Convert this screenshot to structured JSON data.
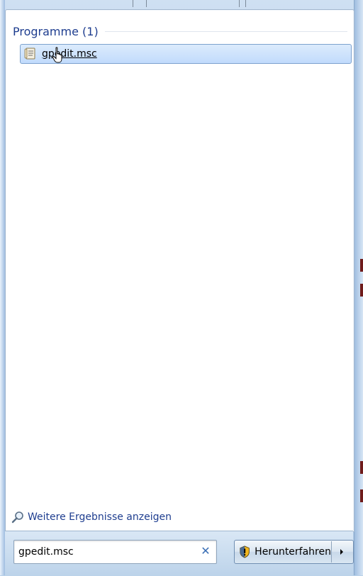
{
  "results": {
    "group_header": "Programme (1)",
    "items": [
      {
        "label": "gpedit.msc",
        "icon": "msc-document-icon"
      }
    ]
  },
  "more_results": {
    "label": "Weitere Ergebnisse anzeigen",
    "icon": "magnifier-icon"
  },
  "search": {
    "value": "gpedit.msc",
    "clear_icon": "clear-x-icon"
  },
  "shutdown": {
    "label": "Herunterfahren",
    "icon": "uac-shield-icon",
    "arrow_icon": "chevron-right-icon"
  },
  "colors": {
    "header_text": "#1e3d8f",
    "selection_fill": "#c1dbfc",
    "selection_border": "#7da2ce",
    "frame": "#a9c5e4"
  }
}
